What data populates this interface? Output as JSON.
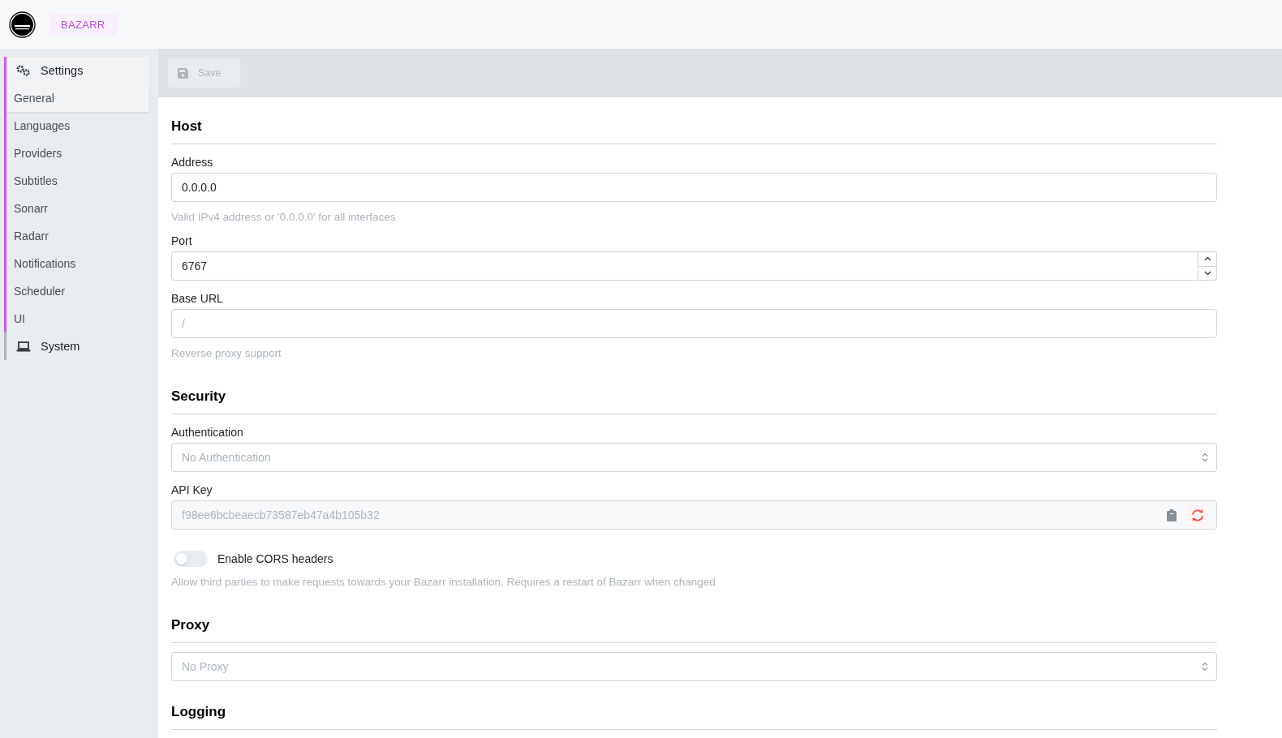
{
  "header": {
    "app_name": "BAZARR"
  },
  "sidebar": {
    "groups": [
      {
        "label": "Settings",
        "expanded": true,
        "children": [
          {
            "label": "General",
            "selected": true
          },
          {
            "label": "Languages",
            "selected": false
          },
          {
            "label": "Providers",
            "selected": false
          },
          {
            "label": "Subtitles",
            "selected": false
          },
          {
            "label": "Sonarr",
            "selected": false
          },
          {
            "label": "Radarr",
            "selected": false
          },
          {
            "label": "Notifications",
            "selected": false
          },
          {
            "label": "Scheduler",
            "selected": false
          },
          {
            "label": "UI",
            "selected": false
          }
        ]
      },
      {
        "label": "System",
        "expanded": false
      }
    ]
  },
  "toolbar": {
    "save": {
      "label": "Save",
      "disabled": true
    }
  },
  "sections": [
    {
      "title": "Host",
      "fields": [
        {
          "kind": "text",
          "label": "Address",
          "value": "0.0.0.0",
          "description": "Valid IPv4 address or '0.0.0.0' for all interfaces"
        },
        {
          "kind": "number",
          "label": "Port",
          "value": "6767"
        },
        {
          "kind": "text",
          "label": "Base URL",
          "placeholder": "/",
          "description": "Reverse proxy support"
        }
      ]
    },
    {
      "title": "Security",
      "fields": [
        {
          "kind": "select",
          "label": "Authentication",
          "placeholder": "No Authentication"
        },
        {
          "kind": "key",
          "label": "API Key",
          "value": "f98ee6bcbeaecb73587eb47a4b105b32",
          "disabled": true
        },
        {
          "kind": "switch",
          "label": "Enable CORS headers",
          "on": false,
          "description": "Allow third parties to make requests towards your Bazarr installation. Requires a restart of Bazarr when changed"
        }
      ]
    },
    {
      "title": "Proxy",
      "fields": [
        {
          "kind": "select",
          "placeholder": "No Proxy"
        }
      ]
    },
    {
      "title": "Logging"
    }
  ]
}
